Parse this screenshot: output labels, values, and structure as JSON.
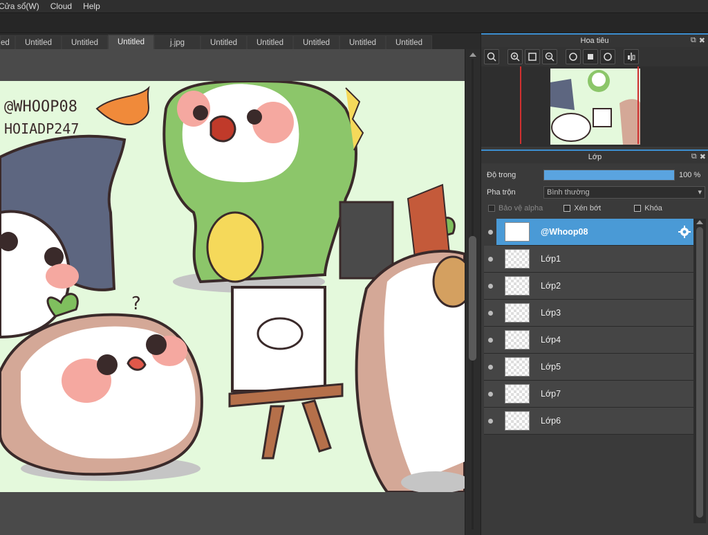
{
  "menu": [
    "Cửa sổ(W)",
    "Cloud",
    "Help"
  ],
  "tabs": [
    {
      "label": "ed",
      "active": false
    },
    {
      "label": "Untitled",
      "active": false
    },
    {
      "label": "Untitled",
      "active": false
    },
    {
      "label": "Untitled",
      "active": true
    },
    {
      "label": "j.jpg",
      "active": false
    },
    {
      "label": "Untitled",
      "active": false
    },
    {
      "label": "Untitled",
      "active": false
    },
    {
      "label": "Untitled",
      "active": false
    },
    {
      "label": "Untitled",
      "active": false
    },
    {
      "label": "Untitled",
      "active": false
    }
  ],
  "artwork": {
    "line1": "@WHOOP08",
    "line2": "HOIADP247"
  },
  "navigator": {
    "title": "Hoa tiêu"
  },
  "layers_panel": {
    "title": "Lớp",
    "opacity_label": "Độ trong",
    "opacity_value": "100 %",
    "opacity_fraction": 1.0,
    "blend_label": "Pha trộn",
    "blend_value": "Bình thường",
    "protect_alpha": "Bảo vệ alpha",
    "clipping": "Xén bớt",
    "lock": "Khóa"
  },
  "layers": [
    {
      "name": "@Whoop08",
      "selected": true
    },
    {
      "name": "Lớp1",
      "selected": false
    },
    {
      "name": "Lớp2",
      "selected": false
    },
    {
      "name": "Lớp3",
      "selected": false
    },
    {
      "name": "Lớp4",
      "selected": false
    },
    {
      "name": "Lớp5",
      "selected": false
    },
    {
      "name": "Lớp7",
      "selected": false
    },
    {
      "name": "Lớp6",
      "selected": false
    }
  ],
  "colors": {
    "accent": "#4a9ad6",
    "canvas_bg": "#e4f9dc",
    "panel": "#3a3a3a"
  }
}
